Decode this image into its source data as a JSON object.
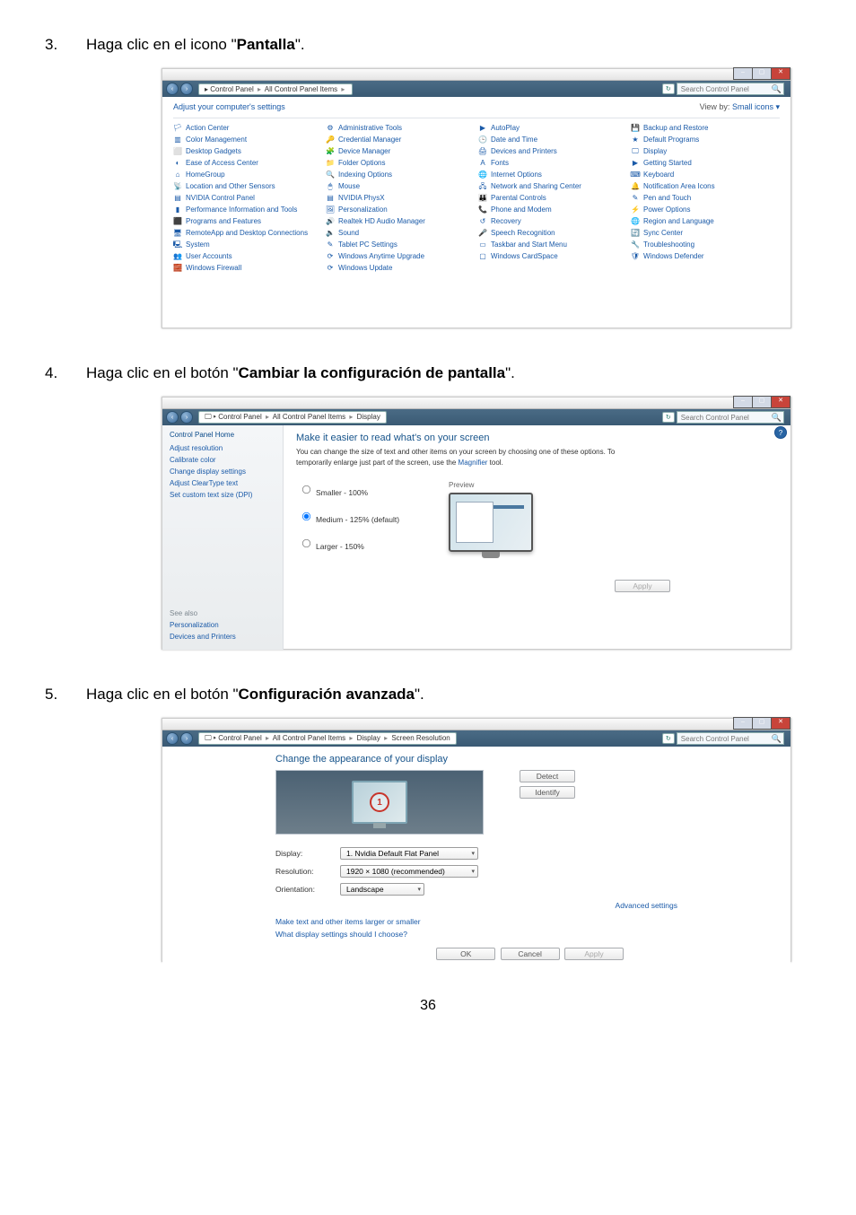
{
  "page_number": "36",
  "step3": {
    "num": "3.",
    "text_before": "Haga clic en el icono \"",
    "bold": "Pantalla",
    "text_after": "\"."
  },
  "step4": {
    "num": "4.",
    "text_before": "Haga clic en el botón \"",
    "bold": "Cambiar la configuración de pantalla",
    "text_after": "\"."
  },
  "step5": {
    "num": "5.",
    "text_before": "Haga clic en el botón \"",
    "bold": "Configuración avanzada",
    "text_after": "\"."
  },
  "ss1": {
    "breadcrumb": [
      "Control Panel",
      "All Control Panel Items"
    ],
    "search_placeholder": "Search Control Panel",
    "title": "Adjust your computer's settings",
    "view_label": "View by:",
    "view_value": "Small icons ▾",
    "items_col1": [
      "Action Center",
      "Color Management",
      "Desktop Gadgets",
      "Ease of Access Center",
      "HomeGroup",
      "Location and Other Sensors",
      "NVIDIA Control Panel",
      "Performance Information and Tools",
      "Programs and Features",
      "RemoteApp and Desktop Connections",
      "System",
      "User Accounts",
      "Windows Firewall"
    ],
    "items_col2": [
      "Administrative Tools",
      "Credential Manager",
      "Device Manager",
      "Folder Options",
      "Indexing Options",
      "Mouse",
      "NVIDIA PhysX",
      "Personalization",
      "Realtek HD Audio Manager",
      "Sound",
      "Tablet PC Settings",
      "Windows Anytime Upgrade",
      "Windows Update"
    ],
    "items_col3": [
      "AutoPlay",
      "Date and Time",
      "Devices and Printers",
      "Fonts",
      "Internet Options",
      "Network and Sharing Center",
      "Parental Controls",
      "Phone and Modem",
      "Recovery",
      "Speech Recognition",
      "Taskbar and Start Menu",
      "Windows CardSpace"
    ],
    "items_col4": [
      "Backup and Restore",
      "Default Programs",
      "Display",
      "Getting Started",
      "Keyboard",
      "Notification Area Icons",
      "Pen and Touch",
      "Power Options",
      "Region and Language",
      "Sync Center",
      "Troubleshooting",
      "Windows Defender"
    ],
    "icons_col1": [
      "🏳",
      "▥",
      "⬜",
      "◐",
      "⌂",
      "📡",
      "▤",
      "▮",
      "⬛",
      "🖥",
      "🖳",
      "👥",
      "🧱"
    ],
    "icons_col2": [
      "⚙",
      "🔑",
      "🧩",
      "📁",
      "🔍",
      "🖱",
      "▤",
      "🖼",
      "🔊",
      "🔈",
      "✎",
      "⟳",
      "⟳"
    ],
    "icons_col3": [
      "▶",
      "🕒",
      "🖨",
      "A",
      "🌐",
      "🖧",
      "👪",
      "📞",
      "↺",
      "🎤",
      "▭",
      "▢"
    ],
    "icons_col4": [
      "💾",
      "★",
      "🖵",
      "▶",
      "⌨",
      "🔔",
      "✎",
      "⚡",
      "🌐",
      "🔄",
      "🔧",
      "🛡"
    ]
  },
  "ss2": {
    "breadcrumb": [
      "Control Panel",
      "All Control Panel Items",
      "Display"
    ],
    "search_placeholder": "Search Control Panel",
    "side": {
      "home": "Control Panel Home",
      "links": [
        "Adjust resolution",
        "Calibrate color",
        "Change display settings",
        "Adjust ClearType text",
        "Set custom text size (DPI)"
      ],
      "see_also": "See also",
      "see_links": [
        "Personalization",
        "Devices and Printers"
      ]
    },
    "main_title": "Make it easier to read what's on your screen",
    "main_desc1": "You can change the size of text and other items on your screen by choosing one of these options. To temporarily enlarge just part of the screen, use the ",
    "main_desc_link": "Magnifier",
    "main_desc2": " tool.",
    "radios": [
      "Smaller - 100%",
      "Medium - 125% (default)",
      "Larger - 150%"
    ],
    "preview_label": "Preview",
    "apply": "Apply"
  },
  "ss3": {
    "breadcrumb": [
      "Control Panel",
      "All Control Panel Items",
      "Display",
      "Screen Resolution"
    ],
    "search_placeholder": "Search Control Panel",
    "title": "Change the appearance of your display",
    "detect": "Detect",
    "identify": "Identify",
    "monitor_num": "1",
    "fields": {
      "display_lbl": "Display:",
      "display_val": "1. Nvidia Default Flat Panel",
      "res_lbl": "Resolution:",
      "res_val": "1920 × 1080 (recommended)",
      "orient_lbl": "Orientation:",
      "orient_val": "Landscape"
    },
    "adv": "Advanced settings",
    "links": [
      "Make text and other items larger or smaller",
      "What display settings should I choose?"
    ],
    "ok": "OK",
    "cancel": "Cancel",
    "apply": "Apply"
  }
}
